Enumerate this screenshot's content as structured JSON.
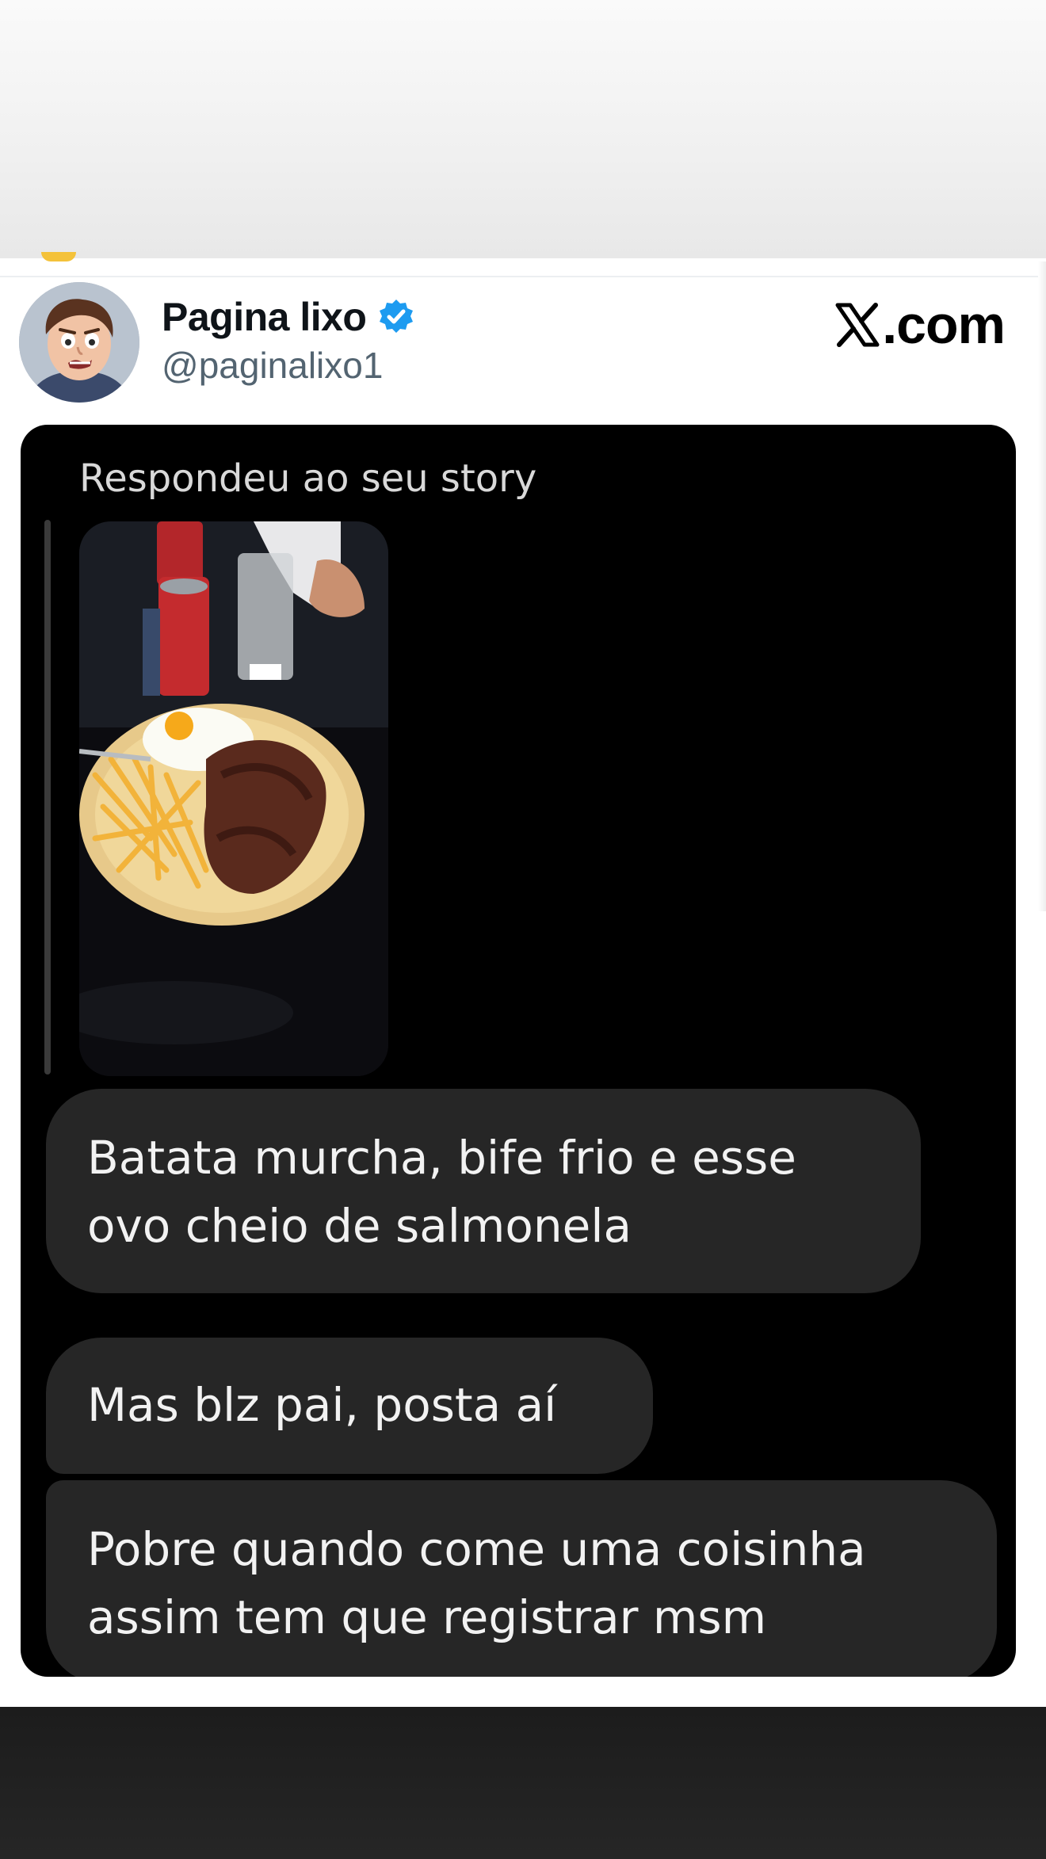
{
  "tweet": {
    "display_name": "Pagina lixo",
    "handle": "@paginalixo1",
    "verified": true,
    "brand": "X.com",
    "brand_suffix": ".com"
  },
  "story_reply": {
    "label": "Respondeu ao seu story",
    "thumbnail": "photo-of-plate-with-fries-steak-and-fried-egg"
  },
  "messages": [
    {
      "text": "Batata murcha, bife frio e esse\novo cheio de salmonela"
    },
    {
      "text": "Mas blz pai, posta aí"
    },
    {
      "text": "Pobre quando come uma coisinha\nassim tem que registrar msm"
    }
  ],
  "colors": {
    "background": "#ffffff",
    "card": "#000000",
    "bubble": "#262626",
    "bubble_text": "#f2f2f2",
    "handle": "#536471",
    "verified_badge": "#1d9bf0"
  },
  "icons": {
    "verified": "verified-badge-icon",
    "brand": "x-logo-icon"
  }
}
